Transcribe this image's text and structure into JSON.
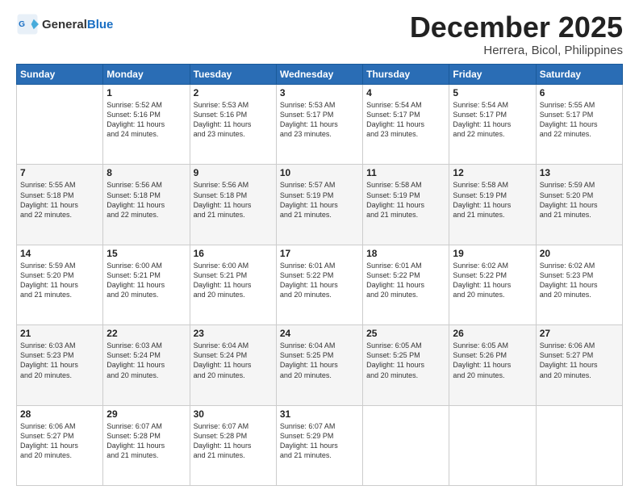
{
  "header": {
    "logo_line1": "General",
    "logo_line2": "Blue",
    "title": "December 2025",
    "subtitle": "Herrera, Bicol, Philippines"
  },
  "days_of_week": [
    "Sunday",
    "Monday",
    "Tuesday",
    "Wednesday",
    "Thursday",
    "Friday",
    "Saturday"
  ],
  "weeks": [
    [
      {
        "day": "",
        "info": ""
      },
      {
        "day": "1",
        "info": "Sunrise: 5:52 AM\nSunset: 5:16 PM\nDaylight: 11 hours\nand 24 minutes."
      },
      {
        "day": "2",
        "info": "Sunrise: 5:53 AM\nSunset: 5:16 PM\nDaylight: 11 hours\nand 23 minutes."
      },
      {
        "day": "3",
        "info": "Sunrise: 5:53 AM\nSunset: 5:17 PM\nDaylight: 11 hours\nand 23 minutes."
      },
      {
        "day": "4",
        "info": "Sunrise: 5:54 AM\nSunset: 5:17 PM\nDaylight: 11 hours\nand 23 minutes."
      },
      {
        "day": "5",
        "info": "Sunrise: 5:54 AM\nSunset: 5:17 PM\nDaylight: 11 hours\nand 22 minutes."
      },
      {
        "day": "6",
        "info": "Sunrise: 5:55 AM\nSunset: 5:17 PM\nDaylight: 11 hours\nand 22 minutes."
      }
    ],
    [
      {
        "day": "7",
        "info": "Sunrise: 5:55 AM\nSunset: 5:18 PM\nDaylight: 11 hours\nand 22 minutes."
      },
      {
        "day": "8",
        "info": "Sunrise: 5:56 AM\nSunset: 5:18 PM\nDaylight: 11 hours\nand 22 minutes."
      },
      {
        "day": "9",
        "info": "Sunrise: 5:56 AM\nSunset: 5:18 PM\nDaylight: 11 hours\nand 21 minutes."
      },
      {
        "day": "10",
        "info": "Sunrise: 5:57 AM\nSunset: 5:19 PM\nDaylight: 11 hours\nand 21 minutes."
      },
      {
        "day": "11",
        "info": "Sunrise: 5:58 AM\nSunset: 5:19 PM\nDaylight: 11 hours\nand 21 minutes."
      },
      {
        "day": "12",
        "info": "Sunrise: 5:58 AM\nSunset: 5:19 PM\nDaylight: 11 hours\nand 21 minutes."
      },
      {
        "day": "13",
        "info": "Sunrise: 5:59 AM\nSunset: 5:20 PM\nDaylight: 11 hours\nand 21 minutes."
      }
    ],
    [
      {
        "day": "14",
        "info": "Sunrise: 5:59 AM\nSunset: 5:20 PM\nDaylight: 11 hours\nand 21 minutes."
      },
      {
        "day": "15",
        "info": "Sunrise: 6:00 AM\nSunset: 5:21 PM\nDaylight: 11 hours\nand 20 minutes."
      },
      {
        "day": "16",
        "info": "Sunrise: 6:00 AM\nSunset: 5:21 PM\nDaylight: 11 hours\nand 20 minutes."
      },
      {
        "day": "17",
        "info": "Sunrise: 6:01 AM\nSunset: 5:22 PM\nDaylight: 11 hours\nand 20 minutes."
      },
      {
        "day": "18",
        "info": "Sunrise: 6:01 AM\nSunset: 5:22 PM\nDaylight: 11 hours\nand 20 minutes."
      },
      {
        "day": "19",
        "info": "Sunrise: 6:02 AM\nSunset: 5:22 PM\nDaylight: 11 hours\nand 20 minutes."
      },
      {
        "day": "20",
        "info": "Sunrise: 6:02 AM\nSunset: 5:23 PM\nDaylight: 11 hours\nand 20 minutes."
      }
    ],
    [
      {
        "day": "21",
        "info": "Sunrise: 6:03 AM\nSunset: 5:23 PM\nDaylight: 11 hours\nand 20 minutes."
      },
      {
        "day": "22",
        "info": "Sunrise: 6:03 AM\nSunset: 5:24 PM\nDaylight: 11 hours\nand 20 minutes."
      },
      {
        "day": "23",
        "info": "Sunrise: 6:04 AM\nSunset: 5:24 PM\nDaylight: 11 hours\nand 20 minutes."
      },
      {
        "day": "24",
        "info": "Sunrise: 6:04 AM\nSunset: 5:25 PM\nDaylight: 11 hours\nand 20 minutes."
      },
      {
        "day": "25",
        "info": "Sunrise: 6:05 AM\nSunset: 5:25 PM\nDaylight: 11 hours\nand 20 minutes."
      },
      {
        "day": "26",
        "info": "Sunrise: 6:05 AM\nSunset: 5:26 PM\nDaylight: 11 hours\nand 20 minutes."
      },
      {
        "day": "27",
        "info": "Sunrise: 6:06 AM\nSunset: 5:27 PM\nDaylight: 11 hours\nand 20 minutes."
      }
    ],
    [
      {
        "day": "28",
        "info": "Sunrise: 6:06 AM\nSunset: 5:27 PM\nDaylight: 11 hours\nand 20 minutes."
      },
      {
        "day": "29",
        "info": "Sunrise: 6:07 AM\nSunset: 5:28 PM\nDaylight: 11 hours\nand 21 minutes."
      },
      {
        "day": "30",
        "info": "Sunrise: 6:07 AM\nSunset: 5:28 PM\nDaylight: 11 hours\nand 21 minutes."
      },
      {
        "day": "31",
        "info": "Sunrise: 6:07 AM\nSunset: 5:29 PM\nDaylight: 11 hours\nand 21 minutes."
      },
      {
        "day": "",
        "info": ""
      },
      {
        "day": "",
        "info": ""
      },
      {
        "day": "",
        "info": ""
      }
    ]
  ]
}
